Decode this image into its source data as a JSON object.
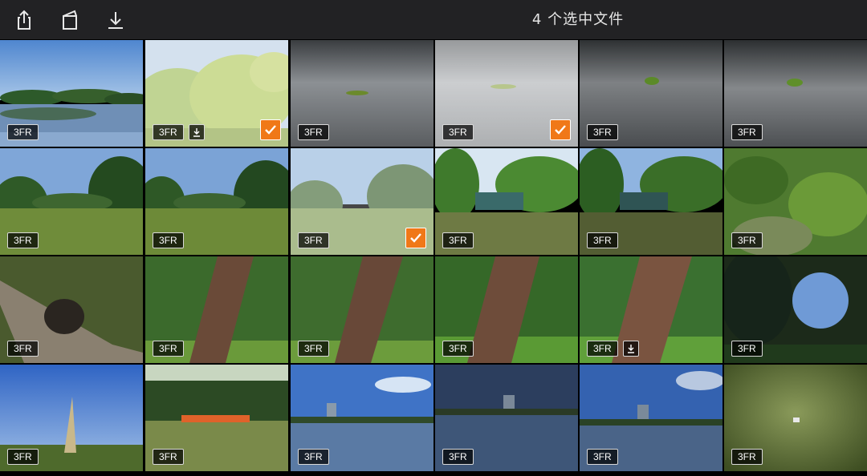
{
  "toolbar": {
    "title": "4 个选中文件",
    "buttons": [
      "share",
      "folder",
      "download"
    ]
  },
  "badge_label": "3FR",
  "tiles": [
    {
      "name": "lake-reflection",
      "row": 0,
      "col": 0,
      "badge": "3FR",
      "selected": false,
      "download": false
    },
    {
      "name": "willow-trees-bright",
      "row": 0,
      "col": 1,
      "badge": "3FR",
      "selected": true,
      "download": true
    },
    {
      "name": "leaf-on-asphalt-1",
      "row": 0,
      "col": 2,
      "badge": "3FR",
      "selected": false,
      "download": false
    },
    {
      "name": "leaf-on-asphalt-2",
      "row": 0,
      "col": 3,
      "badge": "3FR",
      "selected": true,
      "download": false
    },
    {
      "name": "leaf-on-asphalt-3",
      "row": 0,
      "col": 4,
      "badge": "3FR",
      "selected": false,
      "download": false
    },
    {
      "name": "leaf-on-asphalt-4",
      "row": 0,
      "col": 5,
      "badge": "3FR",
      "selected": false,
      "download": false
    },
    {
      "name": "meadow-trees-1",
      "row": 1,
      "col": 0,
      "badge": "3FR",
      "selected": false,
      "download": false
    },
    {
      "name": "meadow-trees-2",
      "row": 1,
      "col": 1,
      "badge": "3FR",
      "selected": false,
      "download": false
    },
    {
      "name": "meadow-trees-3",
      "row": 1,
      "col": 2,
      "badge": "3FR",
      "selected": true,
      "download": false
    },
    {
      "name": "pavilion-lake-1",
      "row": 1,
      "col": 3,
      "badge": "3FR",
      "selected": false,
      "download": false
    },
    {
      "name": "pavilion-lake-2",
      "row": 1,
      "col": 4,
      "badge": "3FR",
      "selected": false,
      "download": false
    },
    {
      "name": "ground-plants",
      "row": 1,
      "col": 5,
      "badge": "3FR",
      "selected": false,
      "download": false
    },
    {
      "name": "tree-stump",
      "row": 2,
      "col": 0,
      "badge": "3FR",
      "selected": false,
      "download": false
    },
    {
      "name": "tree-trunk-1",
      "row": 2,
      "col": 1,
      "badge": "3FR",
      "selected": false,
      "download": false
    },
    {
      "name": "tree-trunk-2",
      "row": 2,
      "col": 2,
      "badge": "3FR",
      "selected": false,
      "download": false
    },
    {
      "name": "tree-trunk-3",
      "row": 2,
      "col": 3,
      "badge": "3FR",
      "selected": false,
      "download": false
    },
    {
      "name": "tree-trunk-4",
      "row": 2,
      "col": 4,
      "badge": "3FR",
      "selected": false,
      "download": true
    },
    {
      "name": "pine-sky",
      "row": 2,
      "col": 5,
      "badge": "3FR",
      "selected": false,
      "download": false
    },
    {
      "name": "grass-sky",
      "row": 3,
      "col": 0,
      "badge": "3FR",
      "selected": false,
      "download": false
    },
    {
      "name": "orange-benches",
      "row": 3,
      "col": 1,
      "badge": "3FR",
      "selected": false,
      "download": false
    },
    {
      "name": "city-lake-1",
      "row": 3,
      "col": 2,
      "badge": "3FR",
      "selected": false,
      "download": false
    },
    {
      "name": "city-lake-2",
      "row": 3,
      "col": 3,
      "badge": "3FR",
      "selected": false,
      "download": false
    },
    {
      "name": "city-lake-3",
      "row": 3,
      "col": 4,
      "badge": "3FR",
      "selected": false,
      "download": false
    },
    {
      "name": "lawn-spot",
      "row": 3,
      "col": 5,
      "badge": "3FR",
      "selected": false,
      "download": false
    }
  ],
  "colors": {
    "toolbar_bg": "#222224",
    "check_orange": "#f07818",
    "title_text": "#e6e6e6"
  }
}
